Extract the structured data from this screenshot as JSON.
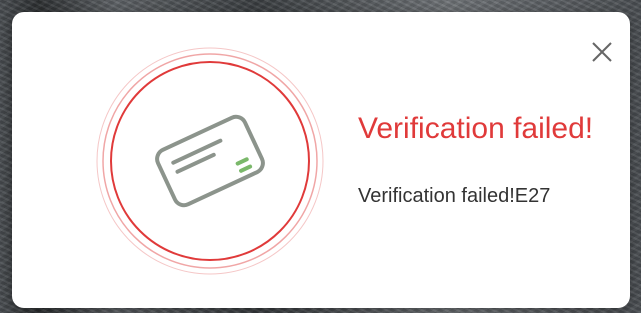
{
  "dialog": {
    "title": "Verification failed!",
    "message": "Verification failed!E27",
    "close_icon": "close-icon",
    "illustration_icon": "card-icon"
  },
  "colors": {
    "error": "#e03a3a",
    "ring_faint": "#f5c7c7",
    "card_stroke": "#8c948c",
    "card_accent": "#7ab86a",
    "text": "#333333"
  }
}
